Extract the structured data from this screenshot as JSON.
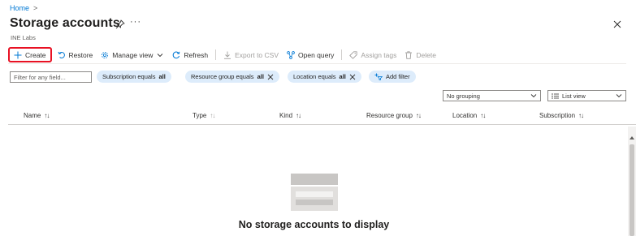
{
  "breadcrumb": {
    "home": "Home",
    "separator": ">"
  },
  "page": {
    "title": "Storage accounts",
    "subtitle": "INE Labs",
    "more": "···"
  },
  "toolbar": {
    "create": "Create",
    "restore": "Restore",
    "manage_view": "Manage view",
    "refresh": "Refresh",
    "export_csv": "Export to CSV",
    "open_query": "Open query",
    "assign_tags": "Assign tags",
    "delete": "Delete"
  },
  "filters": {
    "search_placeholder": "Filter for any field...",
    "subscription": {
      "label": "Subscription equals",
      "value": "all"
    },
    "resource_group": {
      "label": "Resource group equals",
      "value": "all"
    },
    "location": {
      "label": "Location equals",
      "value": "all"
    },
    "add_filter": "Add filter"
  },
  "view_controls": {
    "grouping": "No grouping",
    "view": "List view"
  },
  "table": {
    "columns": [
      "Name",
      "Type",
      "Kind",
      "Resource group",
      "Location",
      "Subscription"
    ]
  },
  "empty_state": {
    "message": "No storage accounts to display"
  },
  "colors": {
    "accent": "#0078d4",
    "pill_bg": "#ddecfb",
    "highlight_border": "#e81123"
  }
}
